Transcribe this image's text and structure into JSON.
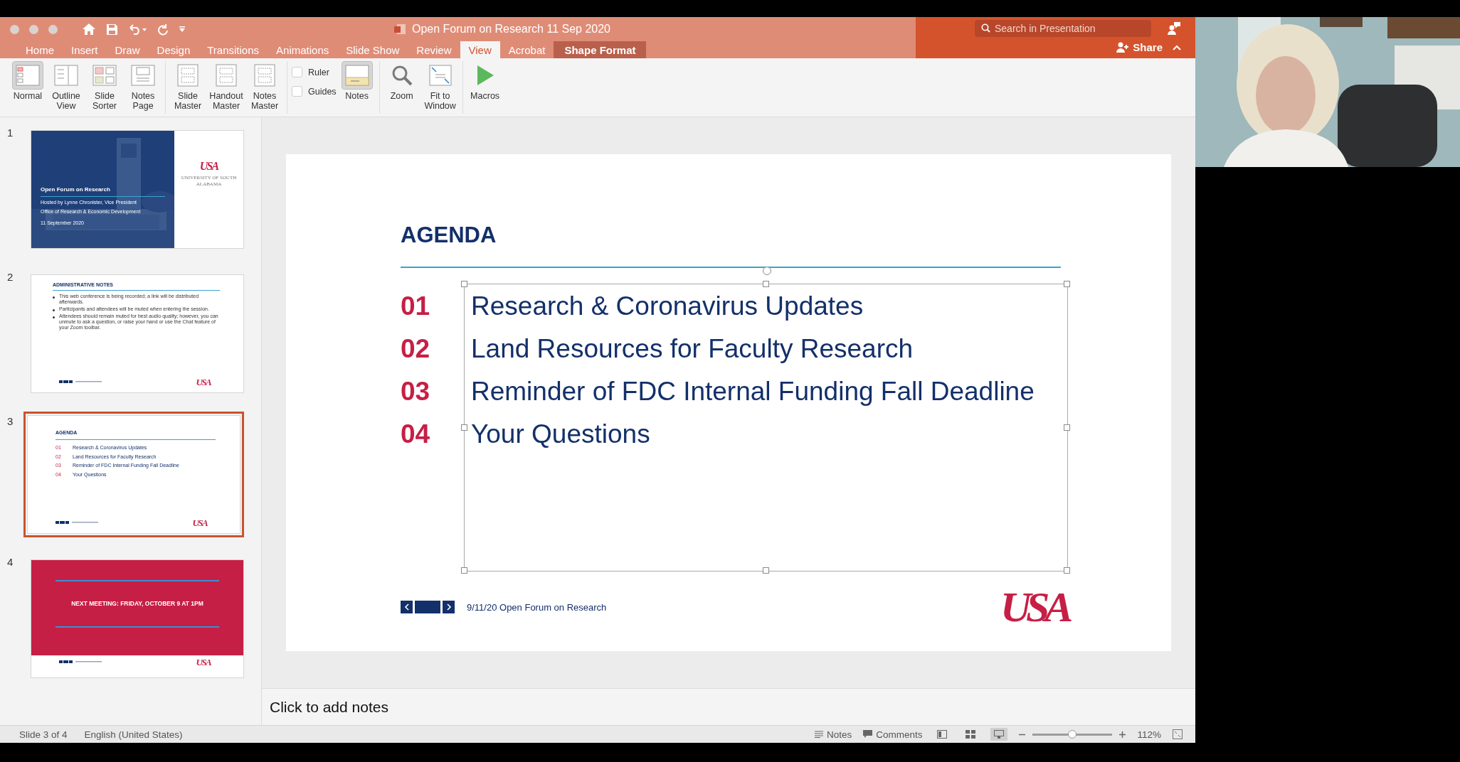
{
  "title_bar": {
    "title": "Open Forum on Research 11 Sep 2020",
    "search": {
      "placeholder": "Search in Presentation"
    },
    "share": "Share"
  },
  "tabs": [
    {
      "label": "Home",
      "selected": false,
      "kind": "standard"
    },
    {
      "label": "Insert",
      "selected": false,
      "kind": "standard"
    },
    {
      "label": "Draw",
      "selected": false,
      "kind": "standard"
    },
    {
      "label": "Design",
      "selected": false,
      "kind": "standard"
    },
    {
      "label": "Transitions",
      "selected": false,
      "kind": "standard"
    },
    {
      "label": "Animations",
      "selected": false,
      "kind": "standard"
    },
    {
      "label": "Slide Show",
      "selected": false,
      "kind": "standard"
    },
    {
      "label": "Review",
      "selected": false,
      "kind": "standard"
    },
    {
      "label": "View",
      "selected": true,
      "kind": "standard"
    },
    {
      "label": "Acrobat",
      "selected": false,
      "kind": "standard"
    },
    {
      "label": "Shape Format",
      "selected": false,
      "kind": "contextual"
    }
  ],
  "ribbon": [
    [
      {
        "kind": "button",
        "label": "Normal",
        "pressed": true
      },
      {
        "kind": "button",
        "label": "Outline View",
        "pressed": false
      },
      {
        "kind": "button",
        "label": "Slide Sorter",
        "pressed": false
      },
      {
        "kind": "button",
        "label": "Notes Page",
        "pressed": false
      }
    ],
    [
      {
        "kind": "button",
        "label": "Slide Master",
        "pressed": false
      },
      {
        "kind": "button",
        "label": "Handout Master",
        "pressed": false
      },
      {
        "kind": "button",
        "label": "Notes Master",
        "pressed": false
      }
    ],
    [
      {
        "kind": "checkbox",
        "label": "Ruler",
        "checked": false
      },
      {
        "kind": "checkbox",
        "label": "Guides",
        "checked": false
      },
      {
        "kind": "button",
        "label": "Notes",
        "pressed": true
      }
    ],
    [
      {
        "kind": "button",
        "label": "Zoom",
        "pressed": false
      },
      {
        "kind": "button",
        "label": "Fit to Window",
        "pressed": false
      }
    ],
    [
      {
        "kind": "button",
        "label": "Macros",
        "pressed": false
      }
    ]
  ],
  "slides": [
    {
      "number": "1",
      "selected": false,
      "kind": "title",
      "title": "Open Forum on Research",
      "lines": [
        "Hosted by Lynne Chronister, Vice President",
        "Office of Research & Economic Development"
      ],
      "date": "11 September 2020",
      "logo": "USA",
      "logo_caption": "UNIVERSITY OF SOUTH ALABAMA"
    },
    {
      "number": "2",
      "selected": false,
      "kind": "bullets",
      "title": "ADMINISTRATIVE NOTES",
      "bullets": [
        "This web conference is being recorded; a link will be distributed afterwards.",
        "Participants and attendees will be muted when entering the session.",
        "Attendees should remain muted for best audio quality; however, you can unmute to ask a question, or raise your hand or use the Chat feature of your Zoom toolbar."
      ],
      "logo": "USA"
    },
    {
      "number": "3",
      "selected": true,
      "kind": "agenda",
      "title": "AGENDA",
      "items": [
        {
          "number": "01",
          "text": "Research & Coronavirus Updates"
        },
        {
          "number": "02",
          "text": "Land Resources for Faculty Research"
        },
        {
          "number": "03",
          "text": "Reminder of FDC Internal Funding Fall Deadline"
        },
        {
          "number": "04",
          "text": "Your Questions"
        }
      ],
      "logo": "USA"
    },
    {
      "number": "4",
      "selected": false,
      "kind": "banner",
      "title": "NEXT MEETING: FRIDAY, OCTOBER 9 AT 1PM",
      "logo": "USA"
    }
  ],
  "slide": {
    "title": "AGENDA",
    "items": [
      {
        "number": "01",
        "text": "Research & Coronavirus Updates"
      },
      {
        "number": "02",
        "text": "Land Resources for Faculty Research"
      },
      {
        "number": "03",
        "text": "Reminder of FDC Internal Funding Fall Deadline"
      },
      {
        "number": "04",
        "text": "Your Questions"
      }
    ],
    "footer": "9/11/20 Open Forum on Research",
    "logo": "USA"
  },
  "notes": {
    "placeholder": "Click to add notes"
  },
  "status_bar": {
    "slide_info": "Slide 3 of 4",
    "language": "English (United States)",
    "notes": "Notes",
    "comments": "Comments",
    "views": [
      {
        "selected": false
      },
      {
        "selected": false
      },
      {
        "selected": true
      }
    ],
    "zoom": {
      "level": 0.5,
      "reading": "112%"
    }
  }
}
